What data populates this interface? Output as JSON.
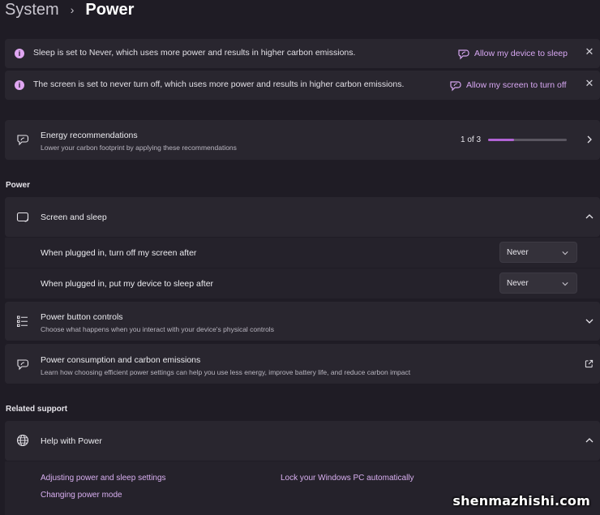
{
  "breadcrumb": {
    "parent": "System",
    "separator": "›",
    "current": "Power"
  },
  "notices": [
    {
      "message": "Sleep is set to Never, which uses more power and results in higher carbon emissions.",
      "action": "Allow my device to sleep",
      "close": "✕"
    },
    {
      "message": "The screen is set to never turn off, which uses more power and results in higher carbon emissions.",
      "action": "Allow my screen to turn off",
      "close": "✕"
    }
  ],
  "energy": {
    "title": "Energy recommendations",
    "subtitle": "Lower your carbon footprint by applying these recommendations",
    "progress_text": "1 of 3",
    "progress_fraction": 0.333
  },
  "power_section": {
    "heading": "Power",
    "screen_sleep": {
      "title": "Screen and sleep",
      "rows": [
        {
          "label": "When plugged in, turn off my screen after",
          "value": "Never"
        },
        {
          "label": "When plugged in, put my device to sleep after",
          "value": "Never"
        }
      ]
    },
    "power_button": {
      "title": "Power button controls",
      "subtitle": "Choose what happens when you interact with your device's physical controls"
    },
    "consumption": {
      "title": "Power consumption and carbon emissions",
      "subtitle": "Learn how choosing efficient power settings can help you use less energy, improve battery life, and reduce carbon impact"
    }
  },
  "related": {
    "heading": "Related support",
    "help": {
      "title": "Help with Power",
      "links": [
        "Adjusting power and sleep settings",
        "Lock your Windows PC automatically",
        "Changing power mode"
      ]
    }
  },
  "watermark": "shenmazhishi.com",
  "colors": {
    "accent": "#d7a7f2",
    "background": "#1f1c25",
    "card": "#29262f",
    "progress_fill": "#b163d4"
  }
}
